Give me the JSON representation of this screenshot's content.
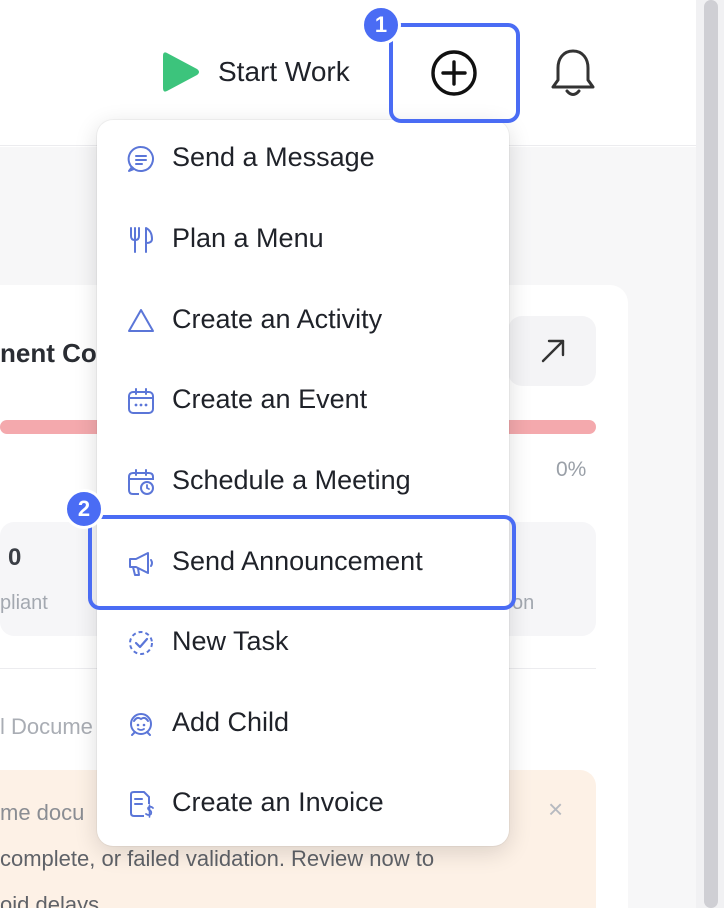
{
  "header": {
    "start_work_label": "Start Work",
    "play_icon": "play-icon",
    "add_icon": "plus-circle-icon",
    "notification_icon": "bell-icon"
  },
  "background": {
    "card_title": "nent Co",
    "progress_percent": "0%",
    "stat_value": "0",
    "stat_label": "pliant",
    "stat_label_right": "on",
    "section_label": "l Docume",
    "alert_line1": "me docu",
    "alert_line2": "complete, or failed validation. Review now to",
    "alert_line3": "oid delays",
    "alert_close": "×"
  },
  "menu": {
    "items": [
      {
        "label": "Send a Message",
        "icon": "message-icon"
      },
      {
        "label": "Plan a Menu",
        "icon": "utensils-icon"
      },
      {
        "label": "Create an Activity",
        "icon": "triangle-icon"
      },
      {
        "label": "Create an Event",
        "icon": "calendar-icon"
      },
      {
        "label": "Schedule a Meeting",
        "icon": "calendar-clock-icon"
      },
      {
        "label": "Send Announcement",
        "icon": "megaphone-icon"
      },
      {
        "label": "New Task",
        "icon": "task-check-icon"
      },
      {
        "label": "Add Child",
        "icon": "child-icon"
      },
      {
        "label": "Create an Invoice",
        "icon": "invoice-icon"
      }
    ]
  },
  "annotations": {
    "step1": "1",
    "step2": "2"
  },
  "colors": {
    "accent": "#4a6cf4",
    "play_green": "#3cc47c",
    "icon_blue": "#5b76d8",
    "progress_red": "#f4a9ad",
    "alert_bg": "#fdf1e6"
  }
}
